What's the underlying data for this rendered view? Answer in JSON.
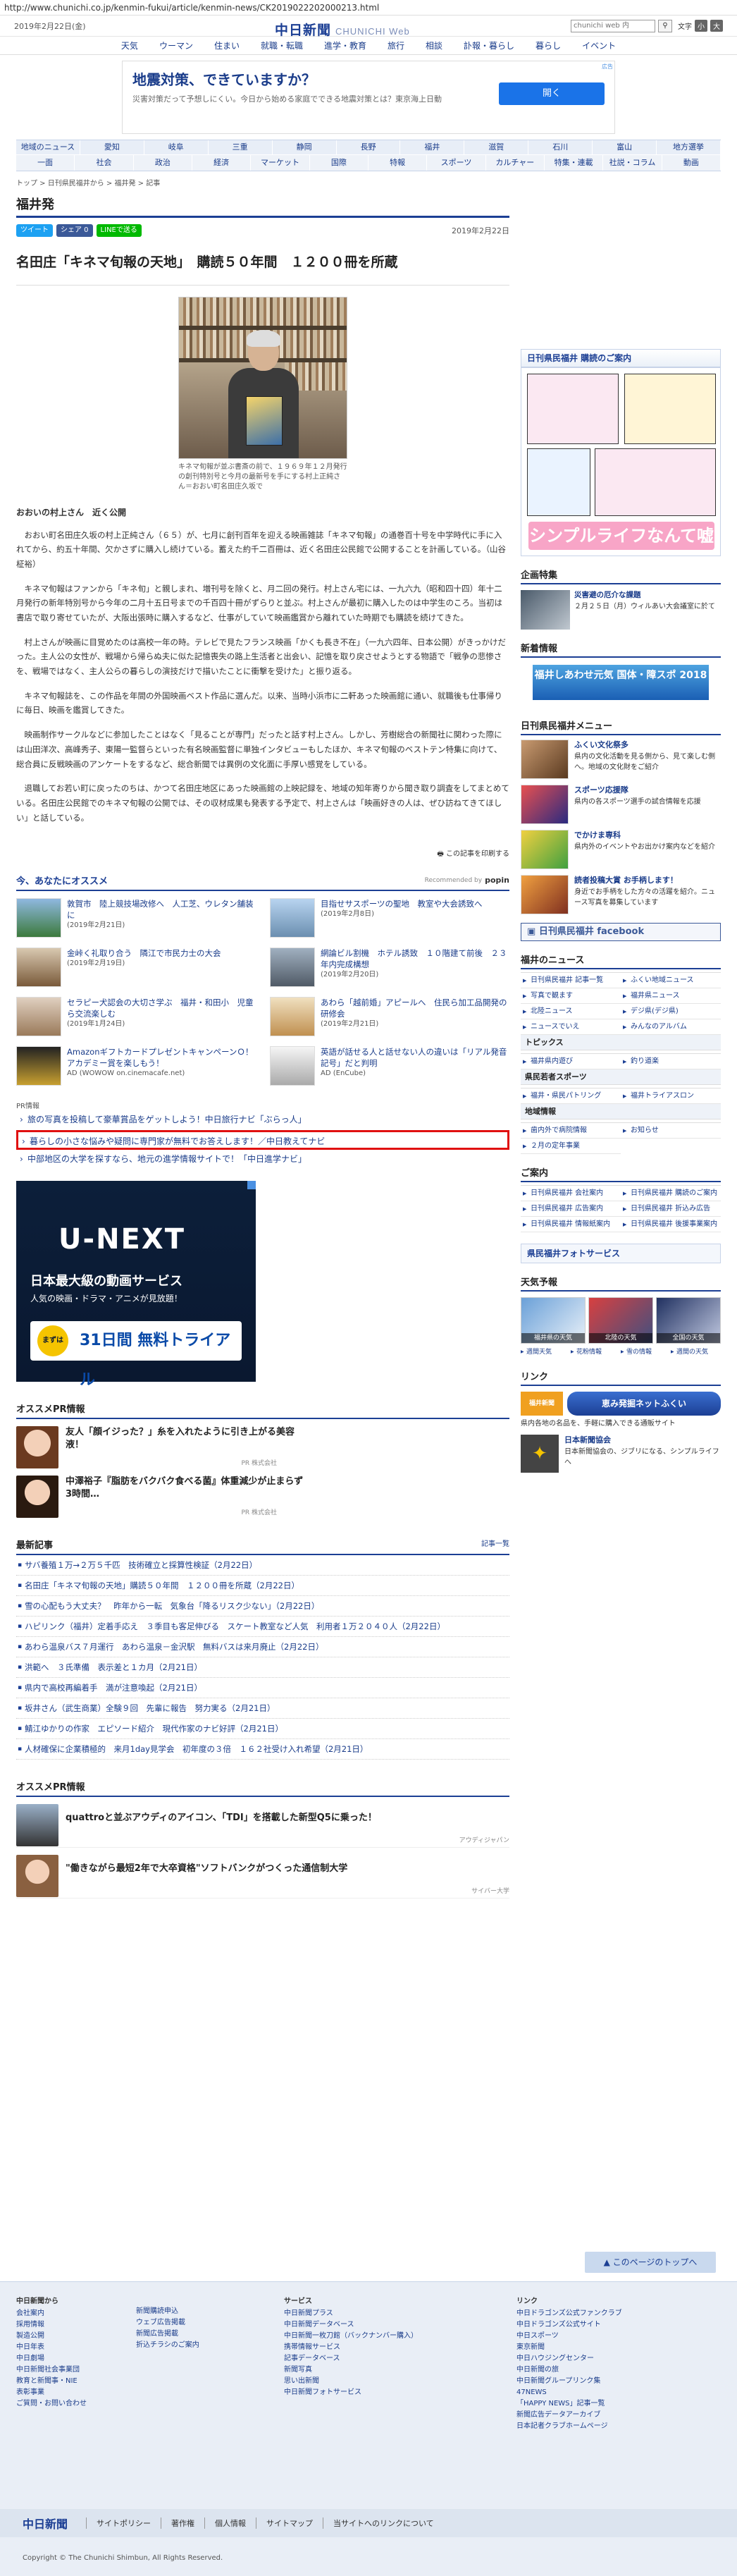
{
  "browser": {
    "url": "http://www.chunichi.co.jp/kenmin-fukui/article/kenmin-news/CK2019022202000213.html"
  },
  "header": {
    "date": "2019年2月22日(金)",
    "logo": "中日新聞",
    "logo_sub": "CHUNICHI Web",
    "search_placeholder": "chunichi web 内",
    "fontsize_label": "文字",
    "fontsize_small": "小",
    "fontsize_large": "大"
  },
  "main_nav": [
    "天気",
    "ウーマン",
    "住まい",
    "就職・転職",
    "進学・教育",
    "旅行",
    "相談",
    "訃報・暮らし",
    "暮らし",
    "イベント"
  ],
  "top_ad": {
    "title": "地震対策、できていますか？",
    "text": "災害対策だって予想しにくい。今日から始める家庭でできる地震対策とは？東京海上日動",
    "button": "開く",
    "mark": "広告"
  },
  "region_nav": [
    "地域のニュース",
    "愛知",
    "岐阜",
    "三重",
    "静岡",
    "長野",
    "福井",
    "滋賀",
    "石川",
    "富山",
    "地方選挙"
  ],
  "category_nav": [
    "一面",
    "社会",
    "政治",
    "経済",
    "マーケット",
    "国際",
    "特報",
    "スポーツ",
    "カルチャー",
    "特集・連載",
    "社説・コラム",
    "動画"
  ],
  "article": {
    "breadcrumb": "トップ > 日刊県民福井から > 福井発 > 記事",
    "section": "福井発",
    "share": {
      "twitter": "ツイート",
      "facebook": "シェア 0",
      "line": "LINEで送る"
    },
    "date": "2019年2月22日",
    "headline": "名田庄「キネマ旬報の天地」　購読５０年間　１２００冊を所蔵",
    "photo_caption": "キネマ旬報が並ぶ書斎の前で、１９６９年１２月発行の創刊特別号と今月の最新号を手にする村上正純さん＝おおい町名田庄久坂で",
    "subhead": "おおいの村上さん　近く公開",
    "paragraphs": [
      "おおい町名田庄久坂の村上正純さん（６５）が、七月に創刊百年を迎える映画雑誌「キネマ旬報」の通巻百十号を中学時代に手に入れてから、約五十年間、欠かさずに購入し続けている。蓄えた約千二百冊は、近く名田庄公民館で公開することを計画している。（山谷柾裕）",
      "キネマ旬報はファンから「キネ旬」と親しまれ、増刊号を除くと、月二回の発行。村上さん宅には、一九六九（昭和四十四）年十二月発行の新年特別号から今年の二月十五日号までの千百四十冊がずらりと並ぶ。村上さんが最初に購入したのは中学生のころ。当初は書店で取り寄せていたが、大阪出張時に購入するなど、仕事がしていて映画鑑賞から離れていた時期でも購読を続けてきた。",
      "村上さんが映画に目覚めたのは高校一年の時。テレビで見たフランス映画「かくも長き不在」（一九六四年、日本公開）がきっかけだった。主人公の女性が、戦場から帰らぬ夫に似た記憶喪失の路上生活者と出会い、記憶を取り戻させようとする物語で「戦争の悲惨さを、戦場ではなく、主人公らの暮らしの演技だけで描いたことに衝撃を受けた」と振り返る。",
      "キネマ旬報誌を、この作品を年間の外国映画ベスト作品に選んだ。以来、当時小浜市に二軒あった映画館に通い、就職後も仕事帰りに毎日、映画を鑑賞してきた。",
      "映画制作サークルなどに参加したことはなく「見ることが専門」だったと話す村上さん。しかし、芳樹総合の新聞社に関わった際には山田洋次、高峰秀子、東陽一監督らといった有名映画監督に単独インタビューもしたほか、キネマ旬報のベストテン特集に向けて、総合員に反戦映画のアンケートをするなど、総合新聞では異例の文化面に手厚い感覚をしている。",
      "退職してお若い町に戻ったのちは、かつて名田庄地区にあった映画館の上映記録を、地域の知年寄りから聞き取り調査をしてまとめている。名田庄公民館でのキネマ旬報の公開では、その収材成果も発表する予定で、村上さんは「映画好きの人は、ぜひ訪ねてきてほしい」と話している。"
    ],
    "print_link": "この記事を印刷する"
  },
  "recommend": {
    "title": "今、あなたにオススメ",
    "recommended_by": "Recommended by",
    "popin": "popin",
    "items": [
      {
        "text": "敦賀市　陸上競技場改修へ　人工芝、ウレタン舗装に",
        "date": "(2019年2月21日)"
      },
      {
        "text": "目指せサスポーツの聖地　教室や大会誘致へ",
        "date": "(2019年2月8日)"
      },
      {
        "text": "金峠く礼取り合う　隣江で市民力士の大会",
        "date": "(2019年2月19日)"
      },
      {
        "text": "網論ビル割機　ホテル誘致　１０階建て前後　２３年内完成構想",
        "date": "(2019年2月20日)"
      },
      {
        "text": "セラピー犬認会の大切さ学ぶ　福井・和田小　児童ら交流楽しむ",
        "date": "(2019年1月24日)"
      },
      {
        "text": "あわら「越前婚」アピールへ　住民ら加工品開発の研修会",
        "date": "(2019年2月21日)"
      },
      {
        "text": "AmazonギフトカードプレゼントキャンペーンＯ！アカデミー賞を楽しもう！",
        "date": "AD (WOWOW on.cinemacafe.net)"
      },
      {
        "text": "英語が話せる人と話せない人の違いは「リアル発音記号」だと判明",
        "date": "AD (EnCube)"
      }
    ]
  },
  "pr": {
    "label": "PR情報",
    "links": [
      "旅の写真を投稿して豪華賞品をゲットしよう！中日旅行ナビ「ぶらっ人」",
      "暮らしの小さな悩みや疑問に専門家が無料でお答えします！／中日教えてナビ",
      "中部地区の大学を探すなら、地元の進学情報サイトで！「中日進学ナビ」"
    ]
  },
  "unext_ad": {
    "logo": "U-NEXT",
    "tagline1": "日本最大級の動画サービス",
    "tagline2": "人気の映画・ドラマ・アニメが見放題！",
    "promo_tag": "まずは",
    "promo": "31日間 無料トライアル"
  },
  "osusume_pr": {
    "title": "オススメPR情報",
    "items": [
      {
        "text": "友人「顔イジった？」糸を入れたように引き上がる美容液！",
        "sponsor": "PR 株式会社"
      },
      {
        "text": "中澤裕子『脂肪をバクバク食べる菌』体重減少が止まらず3時間…",
        "sponsor": "PR 株式会社"
      }
    ]
  },
  "latest": {
    "title": "最新記事",
    "more": "記事一覧",
    "items": [
      "サバ養殖１万→２万５千匹　技術確立と採算性検証（2月22日）",
      "名田庄「キネマ旬報の天地」購読５０年間　１２００冊を所蔵（2月22日）",
      "雪の心配もう大丈夫？　昨年から一転　気象台「降るリスク少ない」（2月22日）",
      "ハピリンク（福井）定着手応え　３季目も客足伸びる　スケート教室など人気　利用者１万２０４０人（2月22日）",
      "あわら温泉バス７月運行　あわら温泉－金沢駅　無料バスは来月廃止（2月22日）",
      "洪範へ　３氏準備　表示差と１カ月（2月21日）",
      "県内で高校再編着手　満が注意喚起（2月21日）",
      "坂井さん（武生商業）全験９回　先輩に報告　努力実る（2月21日）",
      "鯖江ゆかりの作家　エピソード紹介　現代作家のナビ好評（2月21日）",
      "人材確保に企業積極的　来月1day見学会　初年度の３倍　１６２社受け入れ希望（2月21日）"
    ]
  },
  "osusume_pr2": {
    "title": "オススメPR情報",
    "items": [
      {
        "text": "quattroと並ぶアウディのアイコン、「TDI」を搭載した新型Q5に乗った！",
        "sponsor": "アウディジャパン"
      },
      {
        "text": "\"働きながら最短2年で大卒資格\"ソフトバンクがつくった通信制大学",
        "sponsor": "サイバー大学"
      }
    ]
  },
  "sidebar": {
    "subscribe_title": "日刊県民福井 購読のご案内",
    "manga_banner": "シンプルライフなんて嘘",
    "feature_title": "企画特集",
    "feature_item": {
      "title": "災害避の厄介な課題",
      "text": "２月２５日（月）ウィルあい大会議室に於て"
    },
    "new_info_title": "新着情報",
    "new_info_banner": "福井しあわせ元気 国体・障スポ 2018",
    "menu_title": "日刊県民福井メニュー",
    "menu_items": [
      {
        "title": "ふくい文化祭多",
        "text": "県内の文化活動を見る側から、見て楽しむ側へ。地域の文化財をご紹介"
      },
      {
        "title": "スポーツ応援隊",
        "text": "県内の各スポーツ選手の試合情報を応援"
      },
      {
        "title": "でかけま専科",
        "text": "県内外のイベントやお出かけ案内などを紹介"
      },
      {
        "title": "読者投稿大賞 お手柄します！",
        "text": "身近でお手柄をした方々の活躍を紹介。ニュース写真を募集しています"
      }
    ],
    "facebook": "日刊県民福井 facebook",
    "news_title": "福井のニュース",
    "news_links": [
      "日刊県民福井 記事一覧",
      "ふくい地域ニュース",
      "写真で観ます",
      "福井県ニュース",
      "北陸ニュース",
      "デジ県(デジ県)",
      "ニュースでいえ",
      "みんなのアルバム"
    ],
    "topics_title": "トピックス",
    "topics_links": [
      "福井県内遊び",
      "釣り道楽"
    ],
    "sports_title": "県民若者スポーツ",
    "sports_links": [
      "福井・県民パトリング",
      "福井トライアスロン"
    ],
    "local_title": "地域情報",
    "local_links": [
      "歯内外で病院情報",
      "お知らせ",
      "２月の定年事業"
    ],
    "guide_title": "ご案内",
    "guide_links": [
      "日刊県民福井 会社案内",
      "日刊県民福井 購読のご案内",
      "日刊県民福井 広告案内",
      "日刊県民福井 折込み広告",
      "日刊県民福井 情報紙案内",
      "日刊県民福井 後援事業案内"
    ],
    "photo_bar": "県民福井フォトサービス",
    "weather_title": "天気予報",
    "weather_cells": [
      "福井県の天気",
      "北陸の天気",
      "全国の天気"
    ],
    "weather_links": [
      "週間天気",
      "花粉情報",
      "雪の情報",
      "週間の天気"
    ],
    "link_title": "リンク",
    "link_banner_logo": "福井新聞",
    "link_banner": "恵み発掘ネットふくい",
    "link_banner_text": "県内各地の名品を、手軽に購入できる通販サイト",
    "link_item": {
      "title": "日本新聞協会",
      "text": "日本新聞協会の、ジブリになる、シンプルライフへ"
    }
  },
  "totop": "このページのトップへ",
  "footer": {
    "cols": [
      {
        "head": "中日新聞から",
        "links": [
          "会社案内",
          "採用情報",
          "製造公開",
          "中日年表",
          "中日劇場",
          "中日新聞社会事業団",
          "教育と新聞事・NIE",
          "表彰事業",
          "ご質問・お問い合わせ"
        ]
      },
      {
        "head": "",
        "links": [
          "新聞購読申込",
          "ウェブ広告掲載",
          "新聞広告掲載",
          "折込チラシのご案内"
        ]
      },
      {
        "head": "サービス",
        "links": [
          "中日新聞プラス",
          "中日新聞データベース",
          "中日新聞一枚刀館（バックナンバー購入）",
          "携帯情報サービス",
          "記事データベース",
          "新聞写真",
          "思い出新聞",
          "中日新聞フォトサービス"
        ]
      },
      {
        "head": "リンク",
        "links": [
          "中日ドラゴンズ公式ファンクラブ",
          "中日ドラゴンズ公式サイト",
          "中日スポーツ",
          "東京新聞",
          "中日ハウジングセンター",
          "中日新聞の旅",
          "中日新聞グループリンク集",
          "47NEWS",
          "「HAPPY NEWS」記事一覧",
          "新聞広告データアーカイブ",
          "日本記者クラブホームページ"
        ]
      }
    ],
    "bottom_logo": "中日新聞",
    "bottom_links": [
      "サイトポリシー",
      "著作権",
      "個人情報",
      "サイトマップ",
      "当サイトへのリンクについて"
    ],
    "copyright": "Copyright © The Chunichi Shimbun, All Rights Reserved."
  }
}
